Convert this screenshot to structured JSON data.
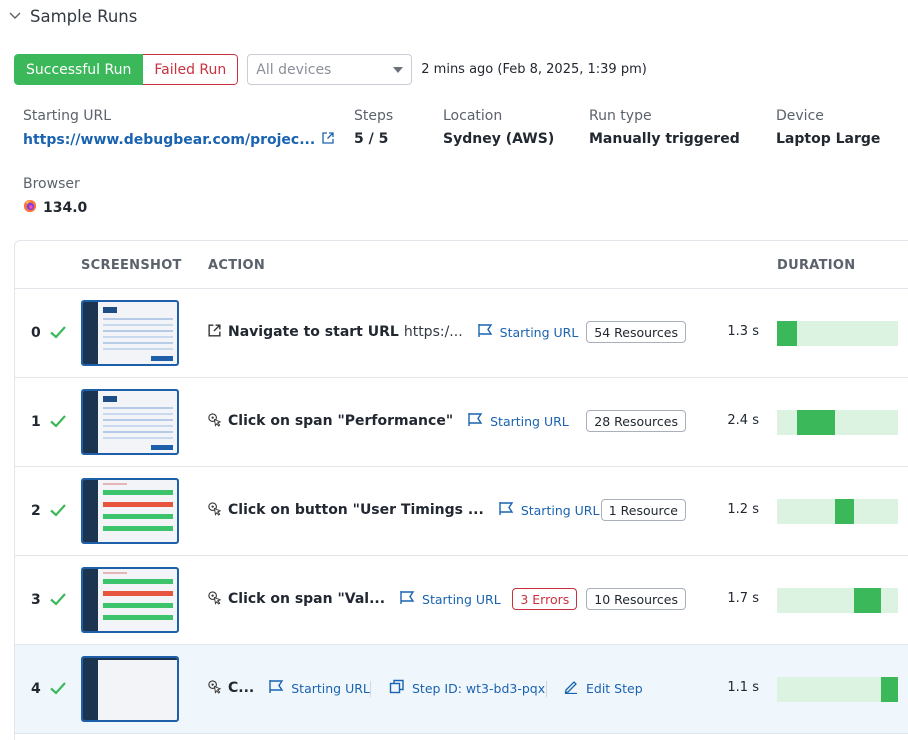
{
  "section": {
    "title": "Sample Runs",
    "icon": "chevron-down-icon"
  },
  "toolbar": {
    "successful_label": "Successful Run",
    "failed_label": "Failed Run",
    "device_select": {
      "value": "All devices",
      "placeholder": "All devices"
    },
    "timestamp": "2 mins ago (Feb 8, 2025, 1:39 pm)"
  },
  "meta": {
    "starting_url": {
      "label": "Starting URL",
      "value": "https://www.debugbear.com/projec..."
    },
    "steps": {
      "label": "Steps",
      "value": "5 / 5"
    },
    "location": {
      "label": "Location",
      "value": "Sydney (AWS)"
    },
    "run_type": {
      "label": "Run type",
      "value": "Manually triggered"
    },
    "device": {
      "label": "Device",
      "value": "Laptop Large"
    },
    "browser": {
      "label": "Browser",
      "value": "134.0",
      "icon": "firefox-icon"
    }
  },
  "table": {
    "headers": {
      "screenshot": "SCREENSHOT",
      "action": "ACTION",
      "duration": "DURATION"
    },
    "rows": [
      {
        "index": "0",
        "status": "success",
        "action_icon": "external-link-icon",
        "action": "Navigate to start URL",
        "action_sub": "https:/...",
        "link": "Starting URL",
        "errors": null,
        "resources": "54 Resources",
        "duration": "1.3 s",
        "duration_s": 1.3,
        "thumb": "page"
      },
      {
        "index": "1",
        "status": "success",
        "action_icon": "click-icon",
        "action": "Click on span \"Performance\"",
        "action_sub": "",
        "link": "Starting URL",
        "errors": null,
        "resources": "28 Resources",
        "duration": "2.4 s",
        "duration_s": 2.4,
        "thumb": "page"
      },
      {
        "index": "2",
        "status": "success",
        "action_icon": "click-icon",
        "action": "Click on button \"User Timings ...",
        "action_sub": "",
        "link": "Starting URL",
        "errors": null,
        "resources": "1 Resource",
        "duration": "1.2 s",
        "duration_s": 1.2,
        "thumb": "grid"
      },
      {
        "index": "3",
        "status": "success",
        "action_icon": "click-icon",
        "action": "Click on span \"Val...",
        "action_sub": "",
        "link": "Starting URL",
        "errors": "3 Errors",
        "resources": "10 Resources",
        "duration": "1.7 s",
        "duration_s": 1.7,
        "thumb": "grid"
      },
      {
        "index": "4",
        "status": "success",
        "action_icon": "click-icon",
        "action": "C...",
        "action_sub": "",
        "link": "Starting URL",
        "step_id": "Step ID: wt3-bd3-pqx",
        "edit": "Edit Step",
        "errors": null,
        "resources": null,
        "duration": "1.1 s",
        "duration_s": 1.1,
        "thumb": "blank"
      }
    ]
  },
  "colors": {
    "success": "#3bb85a",
    "success_light": "#dcf3e2",
    "error": "#c8323f",
    "link": "#1a63b0",
    "highlight_row": "#f0f7fc"
  }
}
